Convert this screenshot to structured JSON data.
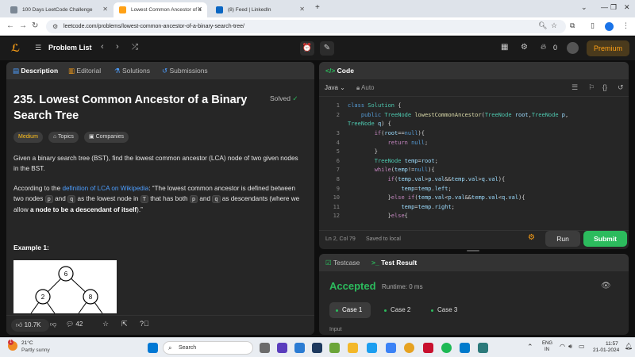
{
  "browser": {
    "tabs": [
      {
        "label": "100 Days LeetCode Challenge",
        "favicon_color": "#7b8794"
      },
      {
        "label": "Lowest Common Ancestor of a",
        "favicon_color": "#ffa116"
      },
      {
        "label": "(8) Feed | LinkedIn",
        "favicon_color": "#0a66c2"
      }
    ],
    "new_tab": "+",
    "url": "leetcode.com/problems/lowest-common-ancestor-of-a-binary-search-tree/"
  },
  "nav": {
    "problem_list": "Problem List",
    "points": "0",
    "premium": "Premium"
  },
  "description": {
    "tabs": [
      "Description",
      "Editorial",
      "Solutions",
      "Submissions"
    ],
    "title": "235. Lowest Common Ancestor of a Binary Search Tree",
    "solved": "Solved",
    "difficulty": "Medium",
    "topics": "Topics",
    "companies": "Companies",
    "p1": "Given a binary search tree (BST), find the lowest common ancestor (LCA) node of two given nodes in the BST.",
    "p2_a": "According to the ",
    "p2_link": "definition of LCA on Wikipedia",
    "p2_b": ": “The lowest common ancestor is defined between two nodes ",
    "p2_p": "p",
    "p2_and": " and ",
    "p2_q": "q",
    "p2_c": " as the lowest node in ",
    "p2_T": "T",
    "p2_d": " that has both ",
    "p2_p2": "p",
    "p2_and2": " and ",
    "p2_q2": "q",
    "p2_e": " as descendants (where we allow ",
    "p2_bold": "a node to be a descendant of itself",
    "p2_f": ").”",
    "example_heading": "Example 1:",
    "tree_nodes": [
      "6",
      "2",
      "8"
    ],
    "likes": "10.7K",
    "comments": "42"
  },
  "code": {
    "header": "Code",
    "language": "Java",
    "mode": "Auto",
    "line_numbers": [
      "1",
      "2",
      "3",
      "4",
      "5",
      "6",
      "7",
      "8",
      "9",
      "10",
      "11",
      "12"
    ],
    "status_position": "Ln 2, Col 79",
    "status_saved": "Saved to local",
    "run": "Run",
    "submit": "Submit"
  },
  "result": {
    "tabs": [
      "Testcase",
      "Test Result"
    ],
    "verdict": "Accepted",
    "runtime": "Runtime: 0 ms",
    "cases": [
      "Case 1",
      "Case 2",
      "Case 3"
    ],
    "input_label": "Input"
  },
  "taskbar": {
    "weather_temp": "21°C",
    "weather_desc": "Partly sunny",
    "weather_badge": "1",
    "search": "Search",
    "lang_1": "ENG",
    "lang_2": "IN",
    "time": "11:57",
    "date": "21-01-2024"
  },
  "colors": {
    "accent_green": "#2cbb5d",
    "medium_yellow": "#ffc01e",
    "premium_orange": "#ffa116",
    "link_blue": "#4d9eff"
  }
}
